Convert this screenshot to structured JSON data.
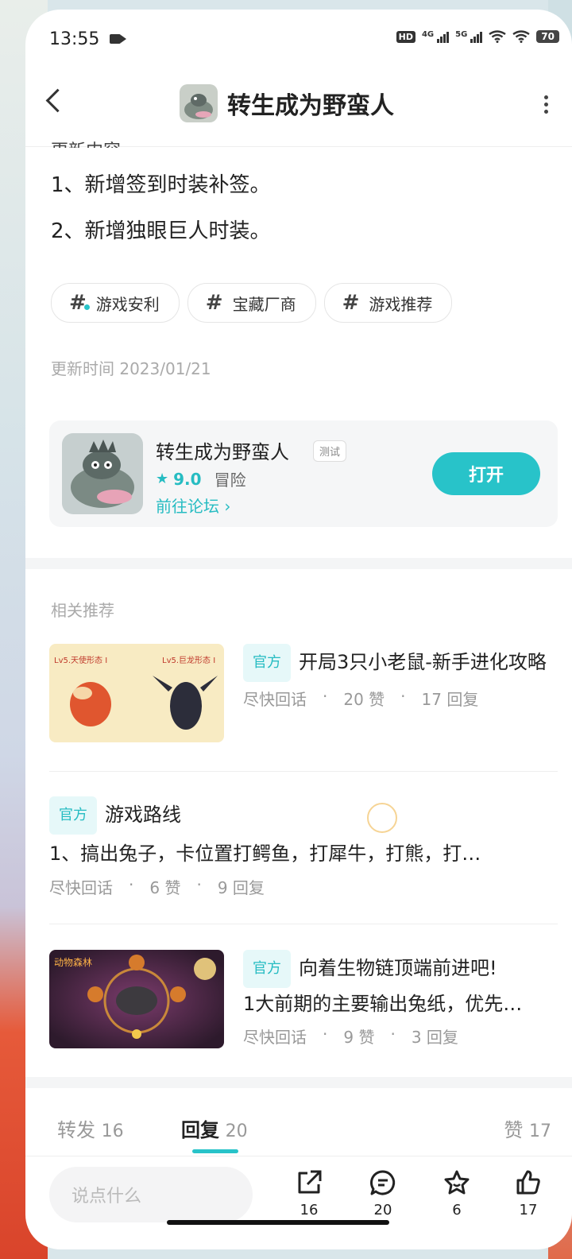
{
  "status": {
    "time": "13:55",
    "hd": "HD",
    "net1": "4G",
    "net2": "5G",
    "battery": "70"
  },
  "header": {
    "title": "转生成为野蛮人"
  },
  "content": {
    "lines": [
      "1、新增签到时装补签。",
      "2、新增独眼巨人时装。"
    ],
    "tags": [
      "游戏安利",
      "宝藏厂商",
      "游戏推荐"
    ],
    "update_time": "更新时间 2023/01/21"
  },
  "game_card": {
    "name": "转生成为野蛮人",
    "badge": "测试",
    "score": "9.0",
    "genre": "冒险",
    "forum_link": "前往论坛",
    "open_label": "打开"
  },
  "related": {
    "title": "相关推荐",
    "posts": [
      {
        "badge": "官方",
        "title": "开局3只小老鼠-新手进化攻略",
        "author": "尽快回话",
        "likes": "20 赞",
        "replies": "17 回复",
        "thumb_left": "Lv5.天使形态 I",
        "thumb_right": "Lv5.巨龙形态 I"
      },
      {
        "badge": "官方",
        "title": "游戏路线",
        "excerpt": "1、搞出兔子，卡位置打鳄鱼，打犀牛，打熊，打…",
        "author": "尽快回话",
        "likes": "6 赞",
        "replies": "9 回复"
      },
      {
        "badge": "官方",
        "title": "向着生物链顶端前进吧!",
        "excerpt": "1大前期的主要输出兔纸，优先…",
        "author": "尽快回话",
        "likes": "9 赞",
        "replies": "3 回复",
        "thumb_label": "动物森林"
      }
    ]
  },
  "tabs": {
    "forward": {
      "label": "转发",
      "count": "16"
    },
    "reply": {
      "label": "回复",
      "count": "20"
    },
    "like": {
      "label": "赞",
      "count": "17"
    }
  },
  "bottom": {
    "input_placeholder": "说点什么",
    "share_count": "16",
    "comment_count": "20",
    "favorite_count": "6",
    "like_count": "17"
  },
  "colors": {
    "accent": "#28c3c9"
  }
}
